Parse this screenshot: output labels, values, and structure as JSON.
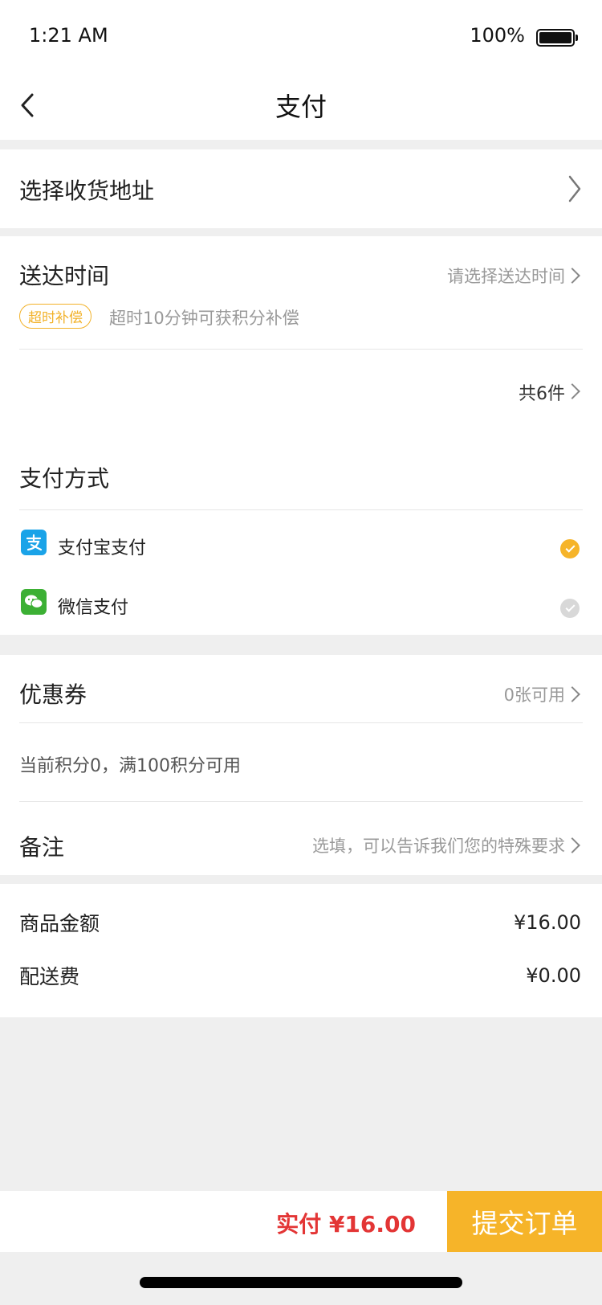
{
  "status_bar": {
    "time": "1:21 AM",
    "battery_pct": "100%"
  },
  "nav": {
    "title": "支付"
  },
  "address": {
    "label": "选择收货地址"
  },
  "delivery": {
    "label": "送达时间",
    "placeholder": "请选择送达时间",
    "tag": "超时补偿",
    "tag_desc": "超时10分钟可获积分补偿",
    "items_count": "共6件"
  },
  "payment": {
    "label": "支付方式",
    "options": [
      {
        "label": "支付宝支付",
        "icon": "alipay-icon",
        "selected": true,
        "color": "#1aa3e8"
      },
      {
        "label": "微信支付",
        "icon": "wechat-icon",
        "selected": false,
        "color": "#3cb034"
      }
    ],
    "selected_color": "#f6b429",
    "unselected_color": "#d8d8d8"
  },
  "coupon": {
    "label": "优惠券",
    "value": "0张可用"
  },
  "points": {
    "text": "当前积分0，满100积分可用"
  },
  "remark": {
    "label": "备注",
    "placeholder": "选填，可以告诉我们您的特殊要求"
  },
  "summary": {
    "goods_label": "商品金额",
    "goods_value": "¥16.00",
    "delivery_label": "配送费",
    "delivery_value": "¥0.00"
  },
  "bottom": {
    "total": "实付 ¥16.00",
    "submit": "提交订单"
  },
  "colors": {
    "accent": "#f6b429",
    "price": "#e33535"
  }
}
